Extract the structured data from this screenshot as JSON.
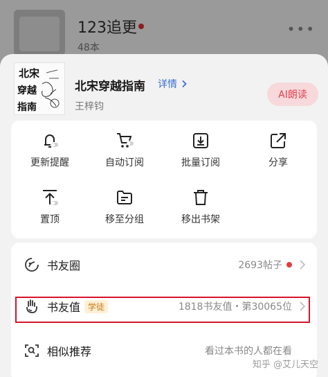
{
  "background_page": {
    "shelf_title": "123追更",
    "shelf_count": "48本",
    "more_label": "•••"
  },
  "book": {
    "cover_text": "北宋穿越指南",
    "title": "北宋穿越指南",
    "details_label": "详情",
    "author": "王梓钧",
    "ai_read_label": "AI朗读"
  },
  "actions": [
    {
      "label": "更新提醒",
      "icon": "bell-icon"
    },
    {
      "label": "自动订阅",
      "icon": "cart-icon"
    },
    {
      "label": "批量订阅",
      "icon": "download-icon"
    },
    {
      "label": "分享",
      "icon": "share-icon"
    },
    {
      "label": "置顶",
      "icon": "pin-top-icon"
    },
    {
      "label": "移至分组",
      "icon": "folder-icon"
    },
    {
      "label": "移出书架",
      "icon": "trash-icon"
    }
  ],
  "list": {
    "circle": {
      "label": "书友圈",
      "value": "2693帖子",
      "icon": "circle-icon"
    },
    "fans": {
      "label": "书友值",
      "badge": "学徒",
      "value": "1818书友值・第30065位",
      "icon": "hand-icon"
    },
    "similar": {
      "label": "相似推荐",
      "value": "看过本书的人都在看",
      "icon": "scan-icon"
    }
  },
  "watermark": "知乎 @艾儿天空",
  "colors": {
    "accent_blue": "#3a6fd0",
    "ai_button_bg": "#f7d9db",
    "ai_button_text": "#e04050",
    "badge_bg": "#fff0d6",
    "badge_text": "#c97a1a",
    "highlight": "#d8142a"
  }
}
